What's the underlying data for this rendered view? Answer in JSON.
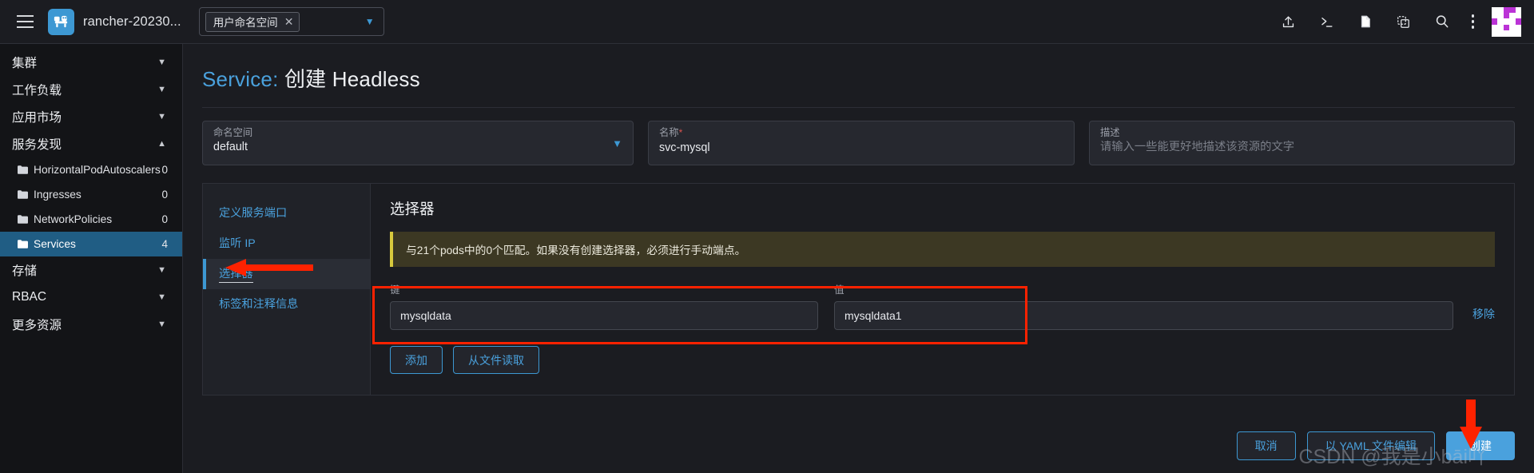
{
  "topbar": {
    "menu_icon": "hamburger-menu-icon",
    "logo_icon": "rancher-logo-icon",
    "cluster_name": "rancher-20230...",
    "namespace_selector": {
      "tag_label": "用户命名空间",
      "close_icon": "close-icon",
      "caret_icon": "chevron-down-icon"
    },
    "icons": [
      {
        "name": "import-yaml-icon",
        "glyph": "upload"
      },
      {
        "name": "kubectl-shell-icon",
        "glyph": "terminal"
      },
      {
        "name": "docs-icon",
        "glyph": "file"
      },
      {
        "name": "kubeconfig-download-icon",
        "glyph": "copy"
      },
      {
        "name": "search-icon",
        "glyph": "search"
      },
      {
        "name": "overflow-menu-icon",
        "glyph": "kebab"
      }
    ],
    "avatar": "user-avatar"
  },
  "sidebar": {
    "groups": [
      {
        "label": "集群",
        "expanded": false
      },
      {
        "label": "工作负载",
        "expanded": false
      },
      {
        "label": "应用市场",
        "expanded": false
      },
      {
        "label": "服务发现",
        "expanded": true
      }
    ],
    "service_discovery_children": [
      {
        "label": "HorizontalPodAutoscalers",
        "count": "0",
        "active": false
      },
      {
        "label": "Ingresses",
        "count": "0",
        "active": false
      },
      {
        "label": "NetworkPolicies",
        "count": "0",
        "active": false
      },
      {
        "label": "Services",
        "count": "4",
        "active": true
      }
    ],
    "groups_after": [
      {
        "label": "存储",
        "expanded": false
      },
      {
        "label": "RBAC",
        "expanded": false
      },
      {
        "label": "更多资源",
        "expanded": false
      }
    ]
  },
  "page": {
    "title_accent": "Service:",
    "title_rest": "创建 Headless"
  },
  "meta": {
    "namespace": {
      "label": "命名空间",
      "value": "default",
      "caret_icon": "chevron-down-icon"
    },
    "name": {
      "label": "名称",
      "required_marker": "*",
      "value": "svc-mysql"
    },
    "description": {
      "label": "描述",
      "placeholder": "请输入一些能更好地描述该资源的文字",
      "value": ""
    }
  },
  "tabs": [
    {
      "label": "定义服务端口",
      "active": false
    },
    {
      "label": "监听 IP",
      "active": false
    },
    {
      "label": "选择器",
      "active": true
    },
    {
      "label": "标签和注释信息",
      "active": false
    }
  ],
  "selector_panel": {
    "title": "选择器",
    "banner": "与21个pods中的0个匹配。如果没有创建选择器，必须进行手动端点。",
    "columns": {
      "key": "键",
      "value": "值"
    },
    "rows": [
      {
        "key": "mysqldata",
        "value": "mysqldata1",
        "remove_label": "移除"
      }
    ],
    "buttons": [
      {
        "label": "添加",
        "style": "outline"
      },
      {
        "label": "从文件读取",
        "style": "outline"
      }
    ]
  },
  "footer": {
    "cancel": "取消",
    "edit_yaml": "以 YAML 文件编辑",
    "create": "创建"
  },
  "watermark": "CSDN @我是小bāi吖",
  "colors": {
    "accent_blue": "#4aa1dd",
    "active_nav": "#205d84",
    "banner_bg": "#3c3823",
    "banner_border": "#d8c93d",
    "annotation_red": "#fe2200",
    "page_bg": "#1b1c21",
    "sidebar_bg": "#131417"
  }
}
